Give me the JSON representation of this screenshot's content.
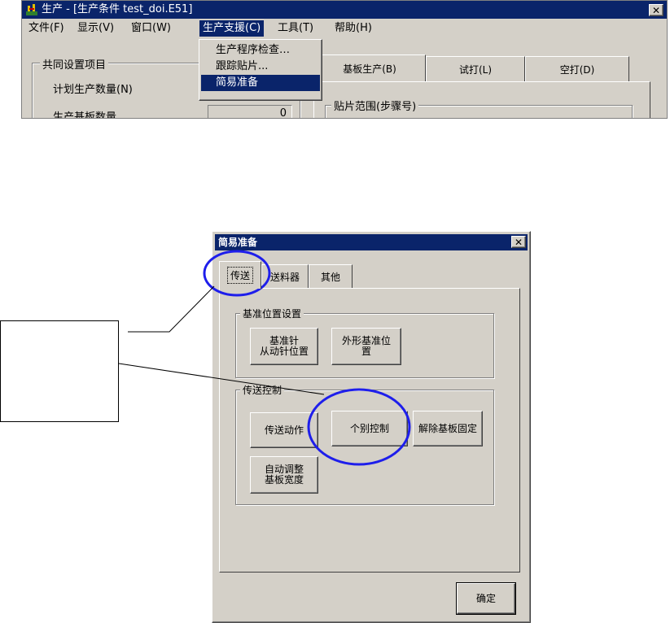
{
  "main_window": {
    "title": "生产 - [生产条件 test_doi.E51]",
    "close_glyph": "✕",
    "menu": [
      "文件(F)",
      "显示(V)",
      "窗口(W)",
      "生产支援(C)",
      "工具(T)",
      "帮助(H)"
    ],
    "submenu": [
      "生产程序检查…",
      "跟踪贴片...",
      "简易准备"
    ],
    "common_group": "共同设置项目",
    "field_plan_qty": "计划生产数量(N)",
    "field_produced_qty": "生产基板数量",
    "produced_value": "0",
    "tabs": [
      "基板生产(B)",
      "试打(L)",
      "空打(D)"
    ],
    "range_group": "贴片范围(步骤号)"
  },
  "dialog": {
    "title": "简易准备",
    "close_glyph": "✕",
    "tabs": [
      "传送",
      "送料器",
      "其他"
    ],
    "group_ref": "基准位置设置",
    "btn_ref_pin": "基准针\n从动针位置",
    "btn_outline_ref": "外形基准位\n置",
    "group_transfer": "传送控制",
    "btn_transfer_action": "传送动作",
    "btn_individual": "个别控制",
    "btn_release": "解除基板固定",
    "btn_auto_width": "自动调整\n基板宽度",
    "btn_ok": "确定"
  },
  "colors": {
    "titlebar_active": "#0a246a",
    "window_face": "#d4d0c8",
    "highlight_circle": "#1e1eeb"
  }
}
